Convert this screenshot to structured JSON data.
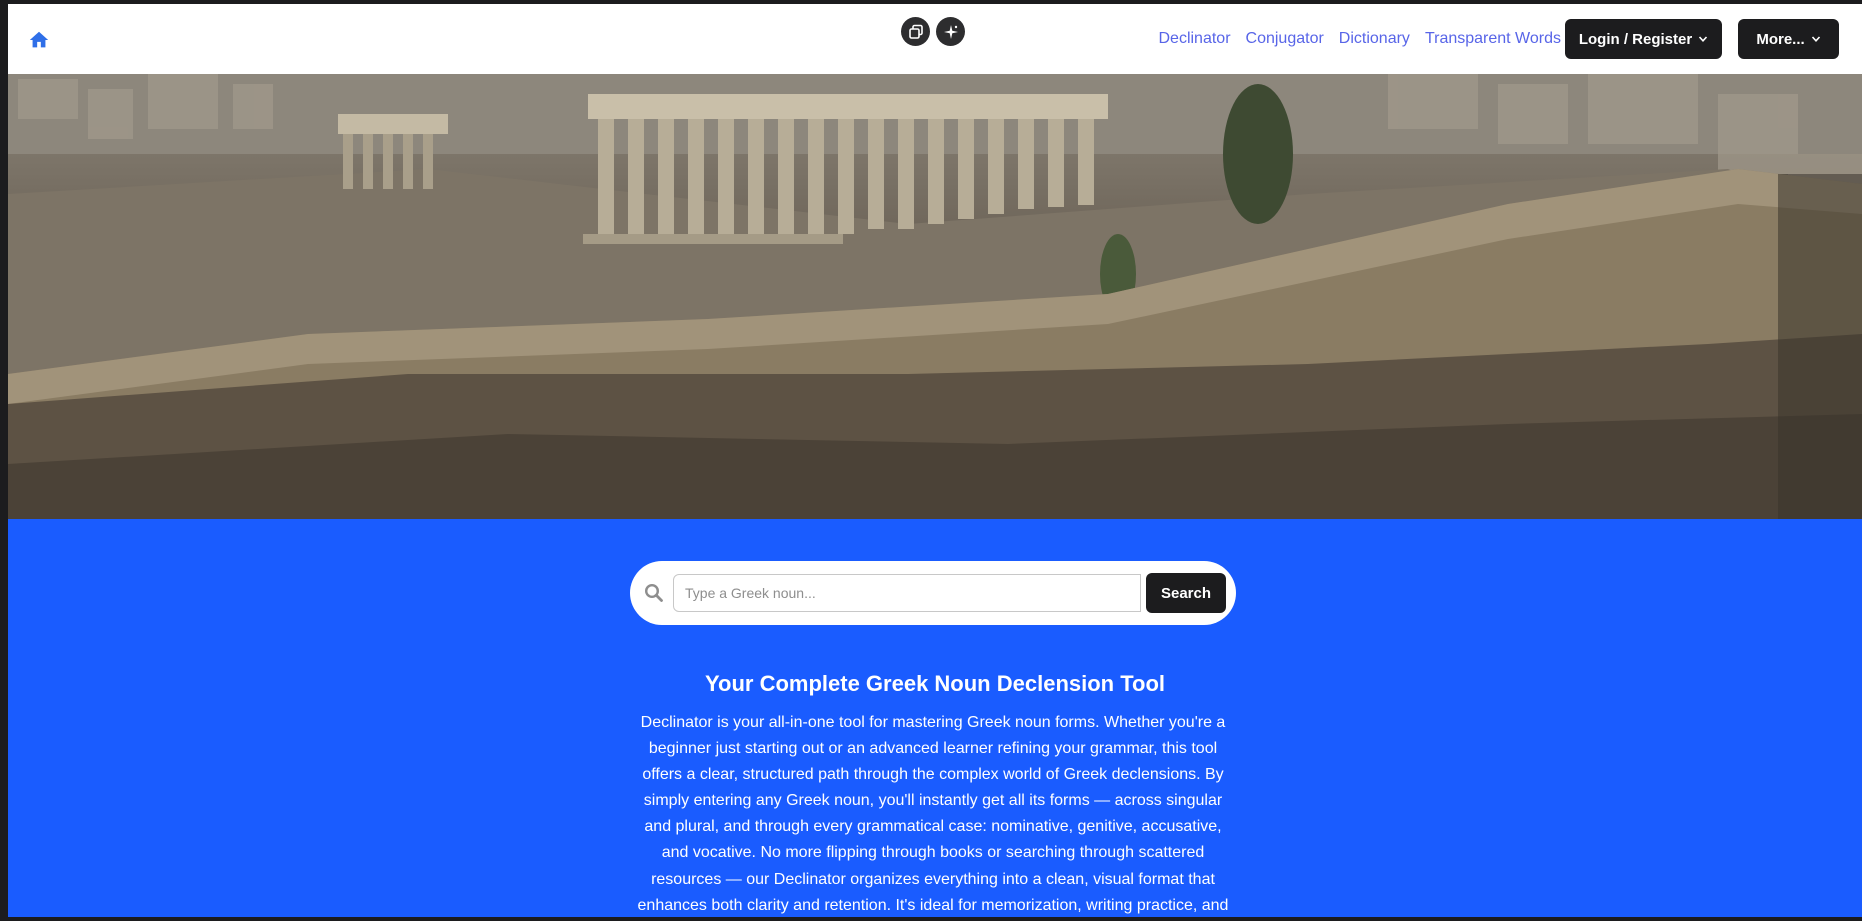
{
  "nav": {
    "home_icon": "home-icon",
    "tools": [
      "copy-icon",
      "sparkle-icon"
    ],
    "links": [
      "Declinator",
      "Conjugator",
      "Dictionary",
      "Transparent Words"
    ],
    "login_label": "Login / Register",
    "more_label": "More..."
  },
  "hero": {
    "image": "Acropolis of Athens aerial view with the Parthenon and surrounding city"
  },
  "search": {
    "placeholder": "Type a Greek noun...",
    "button_label": "Search"
  },
  "main": {
    "title": "Your Complete Greek Noun Declension Tool",
    "description": "Declinator is your all-in-one tool for mastering Greek noun forms. Whether you're a beginner just starting out or an advanced learner refining your grammar, this tool offers a clear, structured path through the complex world of Greek declensions. By simply entering any Greek noun, you'll instantly get all its forms — across singular and plural, and through every grammatical case: nominative, genitive, accusative, and vocative. No more flipping through books or searching through scattered resources — our Declinator organizes everything into a clean, visual format that enhances both clarity and retention. It's ideal for memorization, writing practice, and"
  },
  "colors": {
    "brand_blue": "#1a5cff",
    "nav_link": "#5865e8",
    "dark_button": "#1c1c1e"
  }
}
